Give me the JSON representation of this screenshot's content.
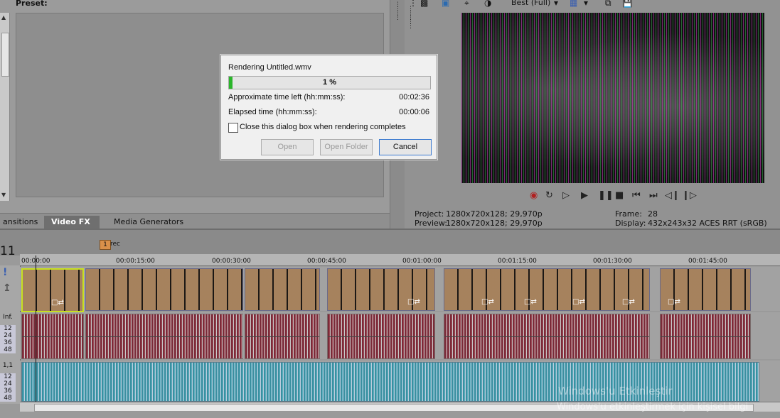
{
  "preset_panel": {
    "label": "Preset:",
    "tabs": [
      "ansitions",
      "Video FX",
      "Media Generators"
    ],
    "active_tab": "Video FX"
  },
  "preview": {
    "quality": "Best (Full)",
    "transport_icons": [
      "record-icon",
      "loop-icon",
      "play-from-start-icon",
      "play-icon",
      "pause-icon",
      "stop-icon",
      "prev-frame-icon",
      "next-frame-icon",
      "prev-marker-icon",
      "next-marker-icon"
    ],
    "project_label": "Project:",
    "project_value": "1280x720x128; 29,970p",
    "preview_label": "Preview:",
    "preview_value": "1280x720x128; 29,970p",
    "frame_label": "Frame:",
    "frame_value": "28",
    "display_label": "Display:",
    "display_value": "432x243x32 ACES RRT (sRGB)"
  },
  "timeline": {
    "track_number": "11",
    "region_marker": "1",
    "region_label": "rec",
    "ruler_ticks": [
      "00:00:00",
      "00:00:15:00",
      "00:00:30:00",
      "00:00:45:00",
      "00:01:00:00",
      "00:01:15:00",
      "00:01:30:00",
      "00:01:45:00"
    ],
    "track_header_labels": [
      "Inf.",
      "12",
      "24",
      "36",
      "48",
      "1,1",
      "12",
      "24",
      "36",
      "48"
    ]
  },
  "dialog": {
    "title": "Rendering Untitled.wmv",
    "progress_percent": 1,
    "progress_text": "1 %",
    "time_left_label": "Approximate time left (hh:mm:ss):",
    "time_left_value": "00:02:36",
    "elapsed_label": "Elapsed time (hh:mm:ss):",
    "elapsed_value": "00:00:06",
    "close_checkbox_label": "Close this dialog box when rendering completes",
    "close_checkbox_checked": false,
    "open_button": "Open",
    "open_folder_button": "Open Folder",
    "cancel_button": "Cancel"
  },
  "watermark": {
    "line1": "Windows'u Etkinleştir",
    "line2": "Windows'u etkinleştirmek için kişisel bilgi"
  },
  "colors": {
    "progress_fill": "#2bb52b",
    "video_track": "#2a2220",
    "audio_track_1": "#7a2a38",
    "audio_track_2": "#3a8fa0",
    "selected_clip_border": "#c8e020"
  }
}
